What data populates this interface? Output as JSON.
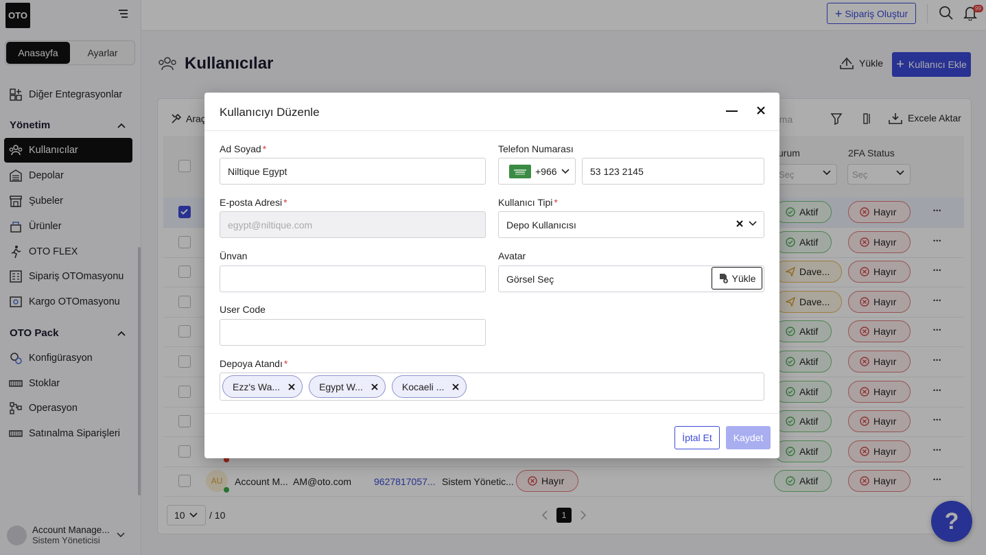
{
  "sidebar": {
    "logo": "OTO",
    "tabs": [
      "Anasayfa",
      "Ayarlar"
    ],
    "items_top": [
      {
        "label": "Diğer Entegrasyonlar",
        "icon": "integrations-icon"
      }
    ],
    "section_management": "Yönetim",
    "items_management": [
      {
        "label": "Kullanıcılar",
        "icon": "users-icon"
      },
      {
        "label": "Depolar",
        "icon": "warehouse-icon"
      },
      {
        "label": "Şubeler",
        "icon": "store-icon"
      },
      {
        "label": "Ürünler",
        "icon": "products-icon"
      },
      {
        "label": "OTO FLEX",
        "icon": "runner-icon"
      },
      {
        "label": "Sipariş OTOmasyonu",
        "icon": "order-automation-icon"
      },
      {
        "label": "Kargo OTOmasyonu",
        "icon": "cargo-automation-icon"
      }
    ],
    "section_pack": "OTO Pack",
    "items_pack": [
      {
        "label": "Konfigürasyon",
        "icon": "config-icon"
      },
      {
        "label": "Stoklar",
        "icon": "stock-icon"
      },
      {
        "label": "Operasyon",
        "icon": "operation-icon"
      },
      {
        "label": "Satınalma Siparişleri",
        "icon": "purchase-icon"
      }
    ],
    "user_name": "Account Manage...",
    "user_role": "Sistem Yöneticisi"
  },
  "topbar": {
    "create_order": "Sipariş Oluştur",
    "notification_count": "99"
  },
  "page": {
    "title": "Kullanıcılar",
    "upload": "Yükle",
    "add_user": "Kullanıcı Ekle",
    "tools": "Araç",
    "search_placeholder": "ama",
    "export": "Excele Aktar"
  },
  "table": {
    "col_status": "urum",
    "col_2fa": "2FA Status",
    "select_placeholder": "Seç",
    "status_rows": [
      {
        "status": "Aktif",
        "status_kind": "ok",
        "twofa": "Hayır"
      },
      {
        "status": "Aktif",
        "status_kind": "ok",
        "twofa": "Hayır"
      },
      {
        "status": "Dave...",
        "status_kind": "inv",
        "twofa": "Hayır"
      },
      {
        "status": "Dave...",
        "status_kind": "inv",
        "twofa": "Hayır"
      },
      {
        "status": "Aktif",
        "status_kind": "ok",
        "twofa": "Hayır"
      },
      {
        "status": "Aktif",
        "status_kind": "ok",
        "twofa": "Hayır"
      },
      {
        "status": "Aktif",
        "status_kind": "ok",
        "twofa": "Hayır"
      },
      {
        "status": "Aktif",
        "status_kind": "ok",
        "twofa": "Hayır"
      },
      {
        "status": "Aktif",
        "status_kind": "ok",
        "twofa": "Hayır"
      },
      {
        "status": "Aktif",
        "status_kind": "ok",
        "twofa": "Hayır"
      }
    ],
    "last_row": {
      "initials": "AU",
      "name": "Account M...",
      "email": "AM@oto.com",
      "phone": "9627817057...",
      "role": "Sistem Yönetic...",
      "admin": "Hayır"
    },
    "page_size": "10",
    "page_total": "/ 10",
    "current_page": "1"
  },
  "modal": {
    "title": "Kullanıcıyı Düzenle",
    "name_label": "Ad Soyad",
    "name_value": "Niltique Egypt",
    "phone_label": "Telefon Numarası",
    "country_code": "+966",
    "phone_value": "53 123 2145",
    "email_label": "E-posta Adresi",
    "email_value": "egypt@niltique.com",
    "user_type_label": "Kullanıcı Tipi",
    "user_type_value": "Depo Kullanıcısı",
    "title_label": "Ünvan",
    "title_value": "",
    "avatar_label": "Avatar",
    "avatar_value": "Görsel Seç",
    "avatar_upload": "Yükle",
    "user_code_label": "User Code",
    "user_code_value": "",
    "warehouse_label": "Depoya Atandı",
    "warehouses": [
      "Ezz's Wa...",
      "Egypt W...",
      "Kocaeli ..."
    ],
    "cancel": "İptal Et",
    "save": "Kaydet",
    "required_mark": "*"
  },
  "help": "?"
}
